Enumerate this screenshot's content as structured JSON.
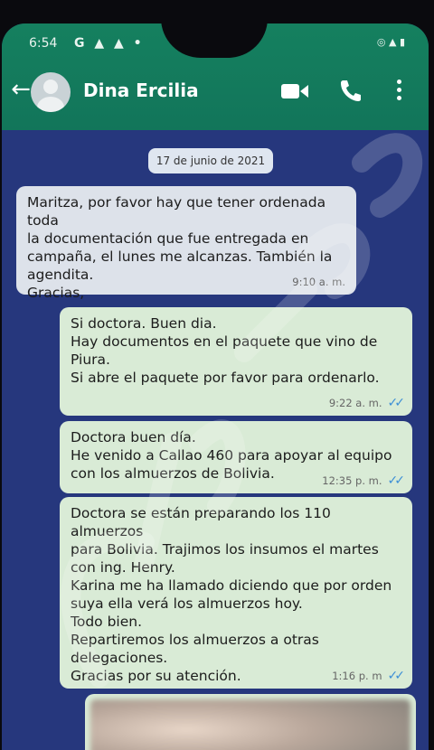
{
  "status_bar": {
    "time": "6:54",
    "icons": "G ▲ ▲ •",
    "right": "◎ ▲ ▮"
  },
  "header": {
    "contact_name": "Dina Ercilia"
  },
  "chat": {
    "date": "17 de junio de 2021",
    "messages": [
      {
        "direction": "in",
        "text": "Maritza, por favor hay que tener ordenada toda\nla documentación que fue entregada en\ncampaña, el lunes me alcanzas. También la\nagendita.\nGracias,",
        "time": "9:10 a. m."
      },
      {
        "direction": "out",
        "text": "Si doctora. Buen dia.\nHay documentos en el paquete que vino de\nPiura.\nSi abre el paquete por favor para ordenarlo.",
        "time": "9:22 a. m."
      },
      {
        "direction": "out",
        "text": "Doctora buen día.\nHe venido a Callao 460 para apoyar al equipo\ncon los almuerzos de Bolivia.",
        "time": "12:35 p. m."
      },
      {
        "direction": "out",
        "text": "Doctora se están preparando los 110 almuerzos\npara Bolivia. Trajimos los insumos el martes\ncon ing. Henry.\nKarina me ha llamado diciendo que por orden\nsuya ella verá los almuerzos hoy.\nTodo bien.\nRepartiremos los almuerzos a otras\ndelegaciones.\nGracias por su atención.",
        "time": "1:16 p. m"
      }
    ],
    "read_ticks": "✓✓"
  },
  "colors": {
    "header": "#12755a",
    "chat_bg": "#26377d",
    "tick": "#3d8fd6"
  }
}
